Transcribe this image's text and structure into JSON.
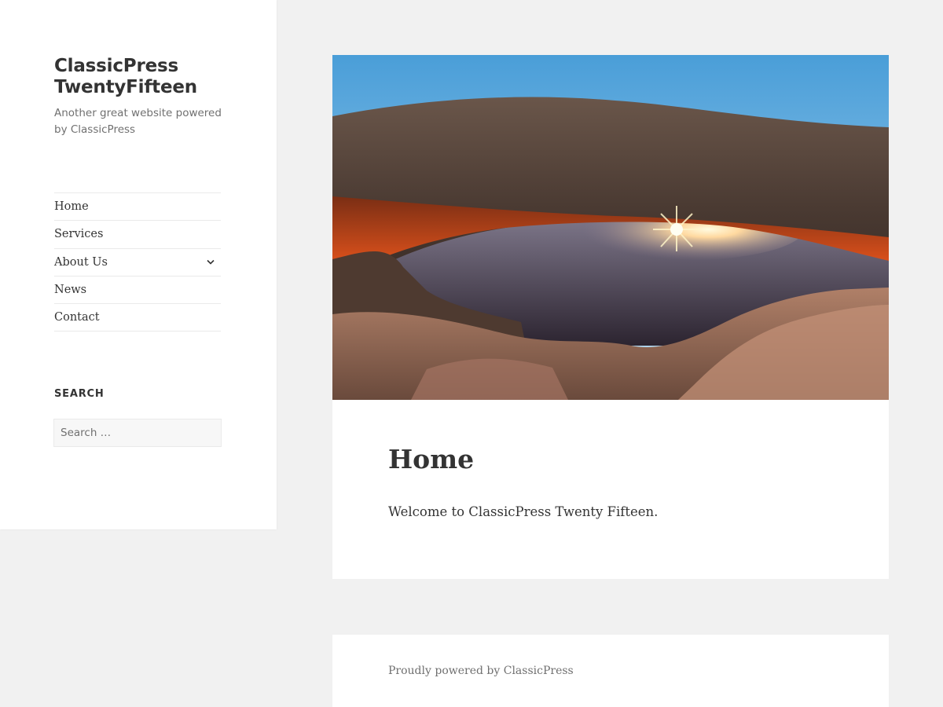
{
  "site": {
    "title_line1": "ClassicPress",
    "title_line2": "TwentyFifteen",
    "tagline": "Another great website powered by ClassicPress"
  },
  "nav": {
    "items": [
      {
        "label": "Home"
      },
      {
        "label": "Services"
      },
      {
        "label": "About Us",
        "has_submenu": true
      },
      {
        "label": "News"
      },
      {
        "label": "Contact"
      }
    ]
  },
  "search_widget": {
    "title": "SEARCH",
    "placeholder": "Search …"
  },
  "article": {
    "hero_image": "canyon-arch-sunrise",
    "title": "Home",
    "content": "Welcome to ClassicPress Twenty Fifteen."
  },
  "footer": {
    "text": "Proudly powered by ClassicPress"
  },
  "colors": {
    "background": "#f1f1f1",
    "panel": "#ffffff",
    "text": "#333333",
    "muted": "#707070",
    "border": "#eaeaea"
  },
  "icons": {
    "submenu": "chevron-down-icon"
  }
}
